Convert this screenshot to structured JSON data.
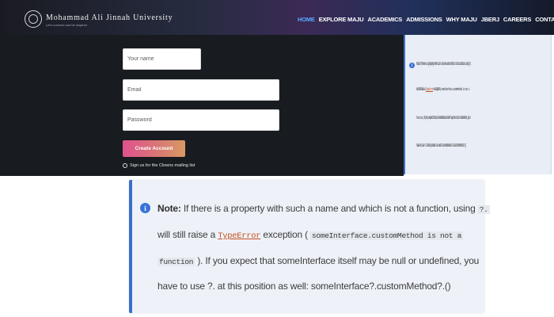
{
  "header": {
    "university_name": "Mohammad Ali Jinnah University",
    "university_tagline": "Let's connect and be inspired",
    "nav_items": [
      "HOME",
      "EXPLORE MAJU",
      "ACADEMICS",
      "ADMISSIONS",
      "WHY MAJU",
      "JBERJ",
      "CAREERS",
      "CONTACT"
    ],
    "active_nav": "HOME",
    "search_icon": "search-icon"
  },
  "form": {
    "name_placeholder": "Your name",
    "email_placeholder": "Email",
    "password_placeholder": "Password",
    "create_button": "Create Account",
    "mailing_label": "Sign us for the Clowns mailing list"
  },
  "note_small": {
    "info_icon": "info-icon",
    "line1": "Note: If there is a property with such a name and which is not a function, using ?.",
    "line2_a": "will still raise a",
    "line2_typeerror": "TypeError",
    "line2_b": "exception (",
    "line2_code": "someInterface.customMethod is not a",
    "line3_code": "function",
    "line3": "). If you expect that someInterface itself may be null or undefined, you",
    "line4": "have to use ?. at this position as well: someInterface?.customMethod?.()"
  },
  "note_large": {
    "info_icon": "info-icon",
    "note_label": "Note:",
    "line1": "If there is a property with such a name and which is not a function, using",
    "line1_code": "?.",
    "line2_a": "will still raise a",
    "line2_typeerror": "TypeError",
    "line2_b": "exception (",
    "line2_code": "someInterface.customMethod is not a",
    "line3_code": "function",
    "line3": "). If you expect that someInterface itself may be null or undefined, you",
    "line4": "have to use ?. at this position as well: someInterface?.customMethod?.()"
  },
  "colors": {
    "accent_blue": "#3b6fc9",
    "active_nav": "#5aa9ff",
    "typeerror": "#c4501e",
    "button_gradient_start": "#e0518f",
    "button_gradient_end": "#d99a62",
    "form_background": "#181b1f"
  }
}
